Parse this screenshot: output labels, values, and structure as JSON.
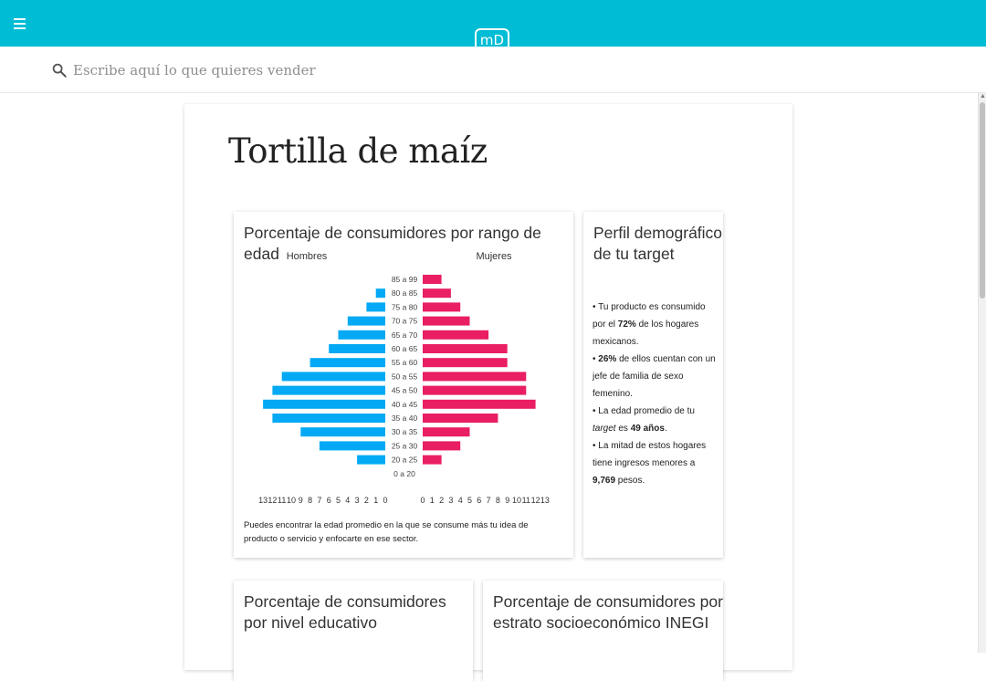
{
  "header": {
    "logo_text": "mD"
  },
  "search": {
    "placeholder": "Escribe aquí lo que quieres vender",
    "value": ""
  },
  "page": {
    "title": "Tortilla de maíz"
  },
  "age_card": {
    "title": "Porcentaje de consumidores por rango de edad",
    "note": "Puedes encontrar la edad promedio en la que se consume más tu idea de producto o servicio y enfocarte en ese sector."
  },
  "chart_data": {
    "type": "bar",
    "orientation": "horizontal-population-pyramid",
    "title": "Porcentaje de consumidores por rango de edad",
    "categories": [
      "85 a 99",
      "80 a 85",
      "75 a 80",
      "70 a 75",
      "65 a 70",
      "60 a 65",
      "55 a 60",
      "50 a 55",
      "45 a 50",
      "40 a 45",
      "35 a 40",
      "30 a 35",
      "25 a 30",
      "20 a 25",
      "0 a 20"
    ],
    "series": [
      {
        "name": "Hombres",
        "color": "#03a9f4",
        "values": [
          0,
          1,
          2,
          4,
          5,
          6,
          8,
          11,
          12,
          13,
          12,
          9,
          7,
          3,
          0
        ]
      },
      {
        "name": "Mujeres",
        "color": "#e91e63",
        "values": [
          2,
          3,
          4,
          5,
          7,
          9,
          9,
          11,
          11,
          12,
          8,
          5,
          4,
          2,
          0
        ]
      }
    ],
    "xlim": [
      0,
      13
    ],
    "xticks_left": [
      "13",
      "12",
      "11",
      "10",
      "9",
      "8",
      "7",
      "6",
      "5",
      "4",
      "3",
      "2",
      "1",
      "0"
    ],
    "xticks_right": [
      "0",
      "1",
      "2",
      "3",
      "4",
      "5",
      "6",
      "7",
      "8",
      "9",
      "10",
      "11",
      "12",
      "13"
    ],
    "grid": false,
    "legend": "top, above each side"
  },
  "profile_card": {
    "title": "Perfil demográfico de tu target",
    "items": [
      {
        "bullet": "•",
        "pre": " Tu producto es consumido por el ",
        "bold": "72%",
        "post": " de los hogares mexicanos."
      },
      {
        "bullet": "•",
        "pre": " ",
        "bold": "26%",
        "post": " de ellos cuentan con un jefe de familia de sexo femenino."
      },
      {
        "bullet": "•",
        "pre": "  La edad promedio de tu ",
        "italic": "target",
        "mid": " es ",
        "bold": "49 años",
        "post": "."
      },
      {
        "bullet": "•",
        "pre": " La mitad de estos hogares tiene ingresos menores a ",
        "bold": "9,769",
        "post": " pesos."
      }
    ]
  },
  "edu_card": {
    "title": "Porcentaje de consumidores por nivel educativo"
  },
  "nse_card": {
    "title": "Porcentaje de consumidores por estrato socioeconómico INEGI"
  },
  "colors": {
    "header": "#00bcd4",
    "men": "#03a9f4",
    "women": "#e91e63"
  }
}
